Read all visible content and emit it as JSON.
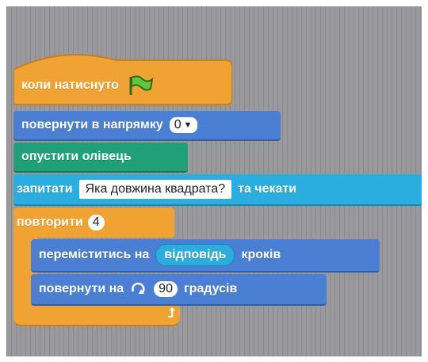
{
  "colors": {
    "events": "#f0a333",
    "motion": "#4a7fd4",
    "pen": "#20a078",
    "sensing": "#2aaee0",
    "canvas": "#9a9a9e"
  },
  "script": {
    "hat": {
      "label": "коли натиснуто",
      "icon": "green-flag-icon"
    },
    "point_direction": {
      "label": "повернути в напрямку",
      "value": "0"
    },
    "pen_down": {
      "label": "опустити олівець"
    },
    "ask": {
      "label_before": "запитати",
      "question": "Яка довжина квадрата?",
      "label_after": "та чекати"
    },
    "repeat": {
      "label": "повторити",
      "times": "4",
      "loop_icon": "loop-arrow-icon"
    },
    "move": {
      "label_before": "переміститись на",
      "reporter": "відповідь",
      "label_after": "кроків"
    },
    "turn": {
      "label_before": "повернути на",
      "icon": "rotate-right-icon",
      "degrees": "90",
      "label_after": "градусів"
    }
  }
}
